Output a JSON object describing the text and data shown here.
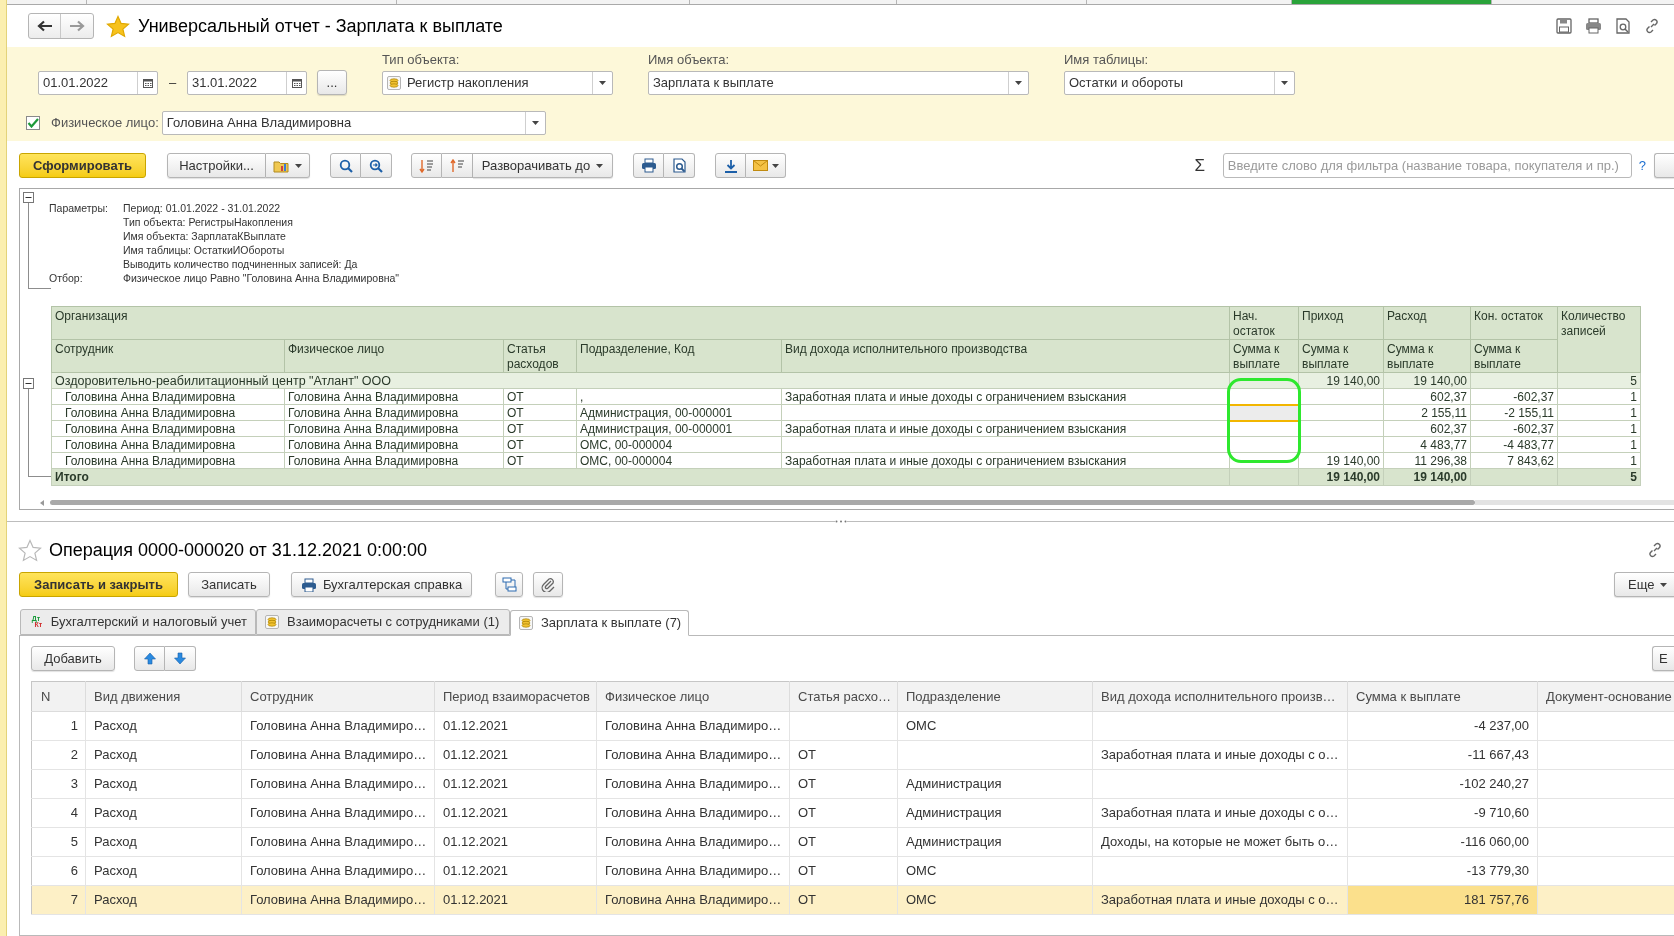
{
  "window": {
    "title": "Универсальный отчет - Зарплата к выплате",
    "favorite": true
  },
  "report_settings": {
    "period_from": "01.01.2022",
    "period_dash": "–",
    "period_to": "31.01.2022",
    "period_button": "...",
    "selectors": [
      {
        "label": "Тип объекта:",
        "value": "Регистр накопления",
        "kind": "register"
      },
      {
        "label": "Имя объекта:",
        "value": "Зарплата к выплате",
        "kind": "plain"
      },
      {
        "label": "Имя таблицы:",
        "value": "Остатки и обороты",
        "kind": "plain"
      }
    ],
    "person_filter": {
      "checked": true,
      "label": "Физическое лицо:",
      "value": "Головина Анна Владимировна"
    }
  },
  "toolbar": {
    "generate": "Сформировать",
    "settings": "Настройки...",
    "expand": "Разворачивать до",
    "sum_sign": "Σ",
    "search_placeholder": "Введите слово для фильтра (название товара, покупателя и пр.)",
    "help": "?"
  },
  "report": {
    "parameters": [
      {
        "label": "Параметры:",
        "lines": [
          "Период: 01.01.2022 - 31.01.2022",
          "Тип объекта: РегистрыНакопления",
          "Имя объекта: ЗарплатаКВыплате",
          "Имя таблицы: ОстаткиИОбороты",
          "Выводить количество подчиненных записей: Да"
        ]
      },
      {
        "label": "Отбор:",
        "lines": [
          "Физическое лицо Равно \"Головина Анна Владимировна\""
        ]
      }
    ],
    "group_header": "Организация",
    "dimension_headers": [
      "Сотрудник",
      "Физическое лицо",
      "Статья расходов",
      "Подразделение, Код",
      "Вид дохода исполнительного производства"
    ],
    "resource_headers": [
      {
        "top": "Нач. остаток",
        "bottom": "Сумма к выплате"
      },
      {
        "top": "Приход",
        "bottom": "Сумма к выплате"
      },
      {
        "top": "Расход",
        "bottom": "Сумма к выплате"
      },
      {
        "top": "Кон. остаток",
        "bottom": "Сумма к выплате"
      }
    ],
    "count_header": "Количество записей",
    "group": {
      "name": "Оздоровительно-реабилитационный центр \"Атлант\" ООО",
      "expanded": true,
      "income": "19 140,00",
      "expense": "19 140,00",
      "count": "5"
    },
    "rows": [
      {
        "employee": "Головина Анна Владимировна",
        "person": "Головина Анна Владимировна",
        "article": "ОТ",
        "department": ",",
        "income_kind": "Заработная плата и иные доходы с ограничением взыскания",
        "expense": "602,37",
        "end": "-602,37",
        "count": "1",
        "selected": false
      },
      {
        "employee": "Головина Анна Владимировна",
        "person": "Головина Анна Владимировна",
        "article": "ОТ",
        "department": "Администрация, 00-000001",
        "expense": "2 155,11",
        "end": "-2 155,11",
        "count": "1",
        "selected": true
      },
      {
        "employee": "Головина Анна Владимировна",
        "person": "Головина Анна Владимировна",
        "article": "ОТ",
        "department": "Администрация, 00-000001",
        "income_kind": "Заработная плата и иные доходы с ограничением взыскания",
        "expense": "602,37",
        "end": "-602,37",
        "count": "1",
        "selected": false
      },
      {
        "employee": "Головина Анна Владимировна",
        "person": "Головина Анна Владимировна",
        "article": "ОТ",
        "department": "ОМС, 00-000004",
        "expense": "4 483,77",
        "end": "-4 483,77",
        "count": "1",
        "selected": false
      },
      {
        "employee": "Головина Анна Владимировна",
        "person": "Головина Анна Владимировна",
        "article": "ОТ",
        "department": "ОМС, 00-000004",
        "income_kind": "Заработная плата и иные доходы с ограничением взыскания",
        "income": "19 140,00",
        "expense": "11 296,38",
        "end": "7 843,62",
        "count": "1",
        "selected": false
      }
    ],
    "total": {
      "label": "Итого",
      "income": "19 140,00",
      "expense": "19 140,00",
      "count": "5"
    }
  },
  "document": {
    "title": "Операция 0000-000020 от 31.12.2021 0:00:00",
    "favorite": false,
    "buttons": {
      "save_close": "Записать и закрыть",
      "save": "Записать",
      "report": "Бухгалтерская справка",
      "more": "Еще"
    },
    "tabs": [
      {
        "label": "Бухгалтерский и налоговый учет",
        "kind": "accounting",
        "badge": [
          "Дт",
          "Кт"
        ],
        "selected": false
      },
      {
        "label": "Взаиморасчеты с сотрудниками (1)",
        "kind": "register",
        "selected": false
      },
      {
        "label": "Зарплата к выплате (7)",
        "kind": "register",
        "selected": true
      }
    ],
    "add_button": "Добавить",
    "side_button": "Е",
    "table": {
      "columns": [
        "N",
        "Вид движения",
        "Сотрудник",
        "Период взаиморасчетов",
        "Физическое лицо",
        "Статья расхо…",
        "Подразделение",
        "Вид дохода исполнительного произв…",
        "Сумма к выплате",
        "Документ-основание"
      ],
      "rows": [
        {
          "n": "1",
          "movement": "Расход",
          "employee": "Головина Анна Владимиро…",
          "period": "01.12.2021",
          "person": "Головина Анна Владимиро…",
          "department": "ОМС",
          "amount": "-4 237,00",
          "selected": false
        },
        {
          "n": "2",
          "movement": "Расход",
          "employee": "Головина Анна Владимиро…",
          "period": "01.12.2021",
          "person": "Головина Анна Владимиро…",
          "article": "ОТ",
          "income_kind": "Заработная плата и иные доходы с о…",
          "amount": "-11 667,43",
          "selected": false
        },
        {
          "n": "3",
          "movement": "Расход",
          "employee": "Головина Анна Владимиро…",
          "period": "01.12.2021",
          "person": "Головина Анна Владимиро…",
          "article": "ОТ",
          "department": "Администрация",
          "amount": "-102 240,27",
          "selected": false
        },
        {
          "n": "4",
          "movement": "Расход",
          "employee": "Головина Анна Владимиро…",
          "period": "01.12.2021",
          "person": "Головина Анна Владимиро…",
          "article": "ОТ",
          "department": "Администрация",
          "income_kind": "Заработная плата и иные доходы с о…",
          "amount": "-9 710,60",
          "selected": false
        },
        {
          "n": "5",
          "movement": "Расход",
          "employee": "Головина Анна Владимиро…",
          "period": "01.12.2021",
          "person": "Головина Анна Владимиро…",
          "article": "ОТ",
          "department": "Администрация",
          "income_kind": "Доходы, на которые не может быть о…",
          "amount": "-116 060,00",
          "selected": false
        },
        {
          "n": "6",
          "movement": "Расход",
          "employee": "Головина Анна Владимиро…",
          "period": "01.12.2021",
          "person": "Головина Анна Владимиро…",
          "article": "ОТ",
          "department": "ОМС",
          "amount": "-13 779,30",
          "selected": false
        },
        {
          "n": "7",
          "movement": "Расход",
          "employee": "Головина Анна Владимиро…",
          "period": "01.12.2021",
          "person": "Головина Анна Владимиро…",
          "article": "ОТ",
          "department": "ОМС",
          "income_kind": "Заработная плата и иные доходы с о…",
          "amount": "181 757,76",
          "selected": true
        }
      ]
    }
  }
}
